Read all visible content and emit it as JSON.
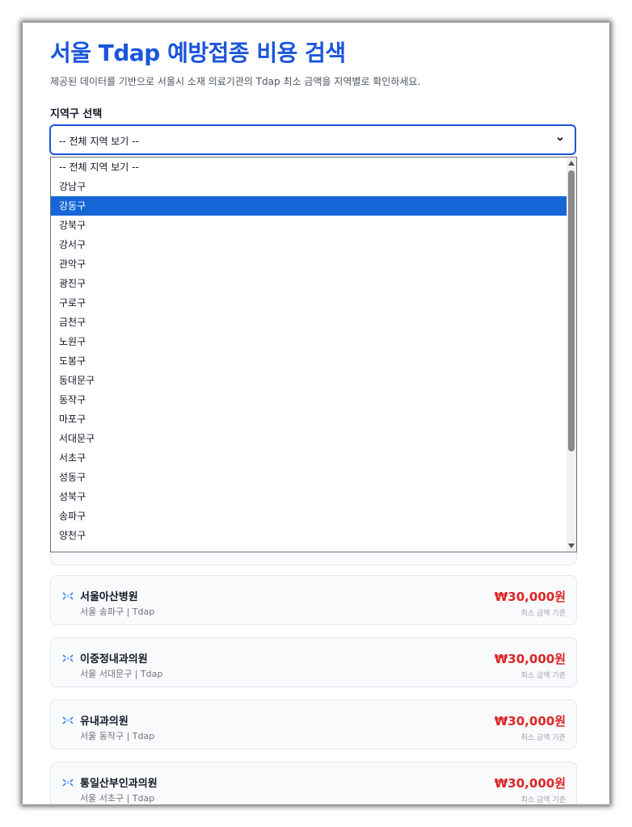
{
  "header": {
    "title": "서울 Tdap 예방접종 비용 검색",
    "subtitle": "제공된 데이터를 기반으로 서울시 소재 의료기관의 Tdap 최소 금액을 지역별로 확인하세요."
  },
  "filter": {
    "label": "지역구 선택",
    "selected_value": "-- 전체 지역 보기 --",
    "highlighted_option": "강동구",
    "options": [
      "-- 전체 지역 보기 --",
      "강남구",
      "강동구",
      "강북구",
      "강서구",
      "관악구",
      "광진구",
      "구로구",
      "금천구",
      "노원구",
      "도봉구",
      "동대문구",
      "동작구",
      "마포구",
      "서대문구",
      "서초구",
      "성동구",
      "성북구",
      "송파구",
      "양천구"
    ]
  },
  "results": [
    {
      "name": "서울아산병원",
      "location": "서울 송파구 | Tdap",
      "price": "₩30,000원",
      "note": "최소 금액 기준"
    },
    {
      "name": "이중정내과의원",
      "location": "서울 서대문구 | Tdap",
      "price": "₩30,000원",
      "note": "최소 금액 기준"
    },
    {
      "name": "유내과의원",
      "location": "서울 동작구 | Tdap",
      "price": "₩30,000원",
      "note": "최소 금액 기준"
    },
    {
      "name": "통일산부인과의원",
      "location": "서울 서초구 | Tdap",
      "price": "₩30,000원",
      "note": "최소 금액 기준"
    }
  ],
  "colors": {
    "accent": "#1a56db",
    "selected_option": "#1666d8",
    "price": "#dc2626"
  },
  "icons": {
    "hospital": "syringe-icon",
    "select": "chevron-down-icon"
  }
}
